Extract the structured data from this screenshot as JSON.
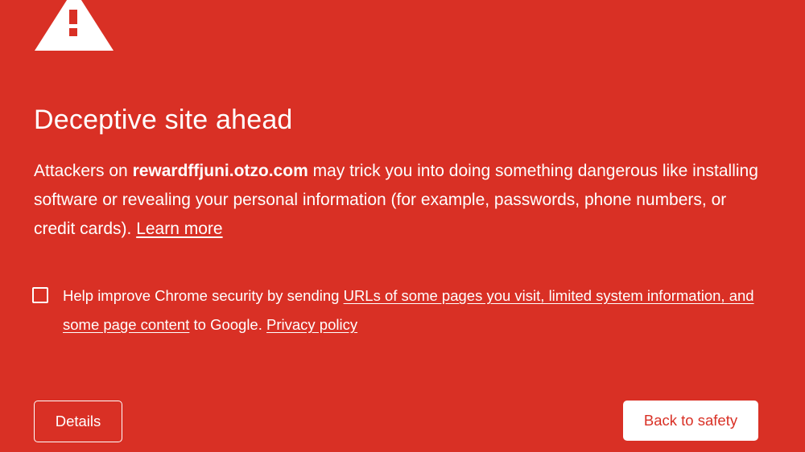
{
  "colors": {
    "background": "#d93025",
    "text": "#ffffff",
    "primary_button_bg": "#ffffff",
    "primary_button_text": "#d93025"
  },
  "icon": {
    "name": "warning-triangle-icon",
    "glyph": "!"
  },
  "title": "Deceptive site ahead",
  "message": {
    "prefix": "Attackers on ",
    "site": "rewardffjuni.otzo.com",
    "suffix": " may trick you into doing something dangerous like installing software or revealing your personal information (for example, passwords, phone numbers, or credit cards). ",
    "learn_more": "Learn more"
  },
  "opt_in": {
    "checked": false,
    "prefix": "Help improve Chrome security by sending ",
    "link": "URLs of some pages you visit, limited system information, and some page content",
    "middle": " to Google. ",
    "privacy_link": "Privacy policy"
  },
  "buttons": {
    "details": "Details",
    "back_to_safety": "Back to safety"
  }
}
